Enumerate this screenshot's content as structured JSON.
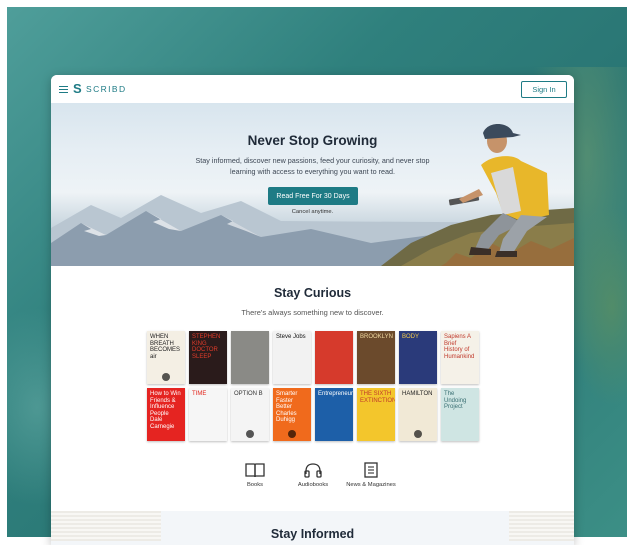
{
  "header": {
    "brand": "SCRIBD",
    "signin_label": "Sign In"
  },
  "hero": {
    "title": "Never Stop Growing",
    "subtitle": "Stay informed, discover new passions, feed your curiosity, and never stop learning with access to everything you want to read.",
    "cta_label": "Read Free For 30 Days",
    "cancel_note": "Cancel anytime."
  },
  "curious": {
    "title": "Stay Curious",
    "subtitle": "There's always something new to discover."
  },
  "books_row1": [
    {
      "title": "WHEN BREATH BECOMES air",
      "bg": "#f4efe4",
      "fg": "#222",
      "audio": true
    },
    {
      "title": "STEPHEN KING DOCTOR SLEEP",
      "bg": "#2a1b1b",
      "fg": "#e23b2a",
      "audio": false
    },
    {
      "title": "",
      "bg": "#8a8a86",
      "fg": "#fff",
      "audio": false
    },
    {
      "title": "Steve Jobs",
      "bg": "#f2f2f2",
      "fg": "#111",
      "audio": false
    },
    {
      "title": "",
      "bg": "#d63a2c",
      "fg": "#fff",
      "audio": false
    },
    {
      "title": "BROOKLYN",
      "bg": "#6b4a2c",
      "fg": "#f0d8a0",
      "audio": false
    },
    {
      "title": "BODY",
      "bg": "#2a3a7a",
      "fg": "#f2c94a",
      "audio": false
    },
    {
      "title": "Sapiens A Brief History of Humankind",
      "bg": "#f5f1e8",
      "fg": "#c0392b",
      "audio": false
    }
  ],
  "books_row2": [
    {
      "title": "How to Win Friends & Influence People Dale Carnegie",
      "bg": "#e52421",
      "fg": "#fff",
      "audio": false
    },
    {
      "title": "TIME",
      "bg": "#f6f6f6",
      "fg": "#e2231a",
      "audio": false
    },
    {
      "title": "OPTION B",
      "bg": "#f4f4f4",
      "fg": "#333",
      "audio": true
    },
    {
      "title": "Smarter Faster Better Charles Duhigg",
      "bg": "#f06a1c",
      "fg": "#fff",
      "audio": true
    },
    {
      "title": "Entrepreneur",
      "bg": "#1d5fa8",
      "fg": "#fff",
      "audio": false
    },
    {
      "title": "THE SIXTH EXTINCTION",
      "bg": "#f3c62c",
      "fg": "#c0392b",
      "audio": false
    },
    {
      "title": "HAMILTON",
      "bg": "#f1e9d6",
      "fg": "#222",
      "audio": true
    },
    {
      "title": "The Undoing Project",
      "bg": "#cfe5e3",
      "fg": "#3a6f73",
      "audio": false
    }
  ],
  "categories": [
    {
      "label": "Books",
      "icon": "book-icon"
    },
    {
      "label": "Audiobooks",
      "icon": "headphones-icon"
    },
    {
      "label": "News & Magazines",
      "icon": "newspaper-icon"
    }
  ],
  "informed": {
    "title": "Stay Informed"
  },
  "colors": {
    "accent": "#1e7b85",
    "background": "#2f807d"
  }
}
